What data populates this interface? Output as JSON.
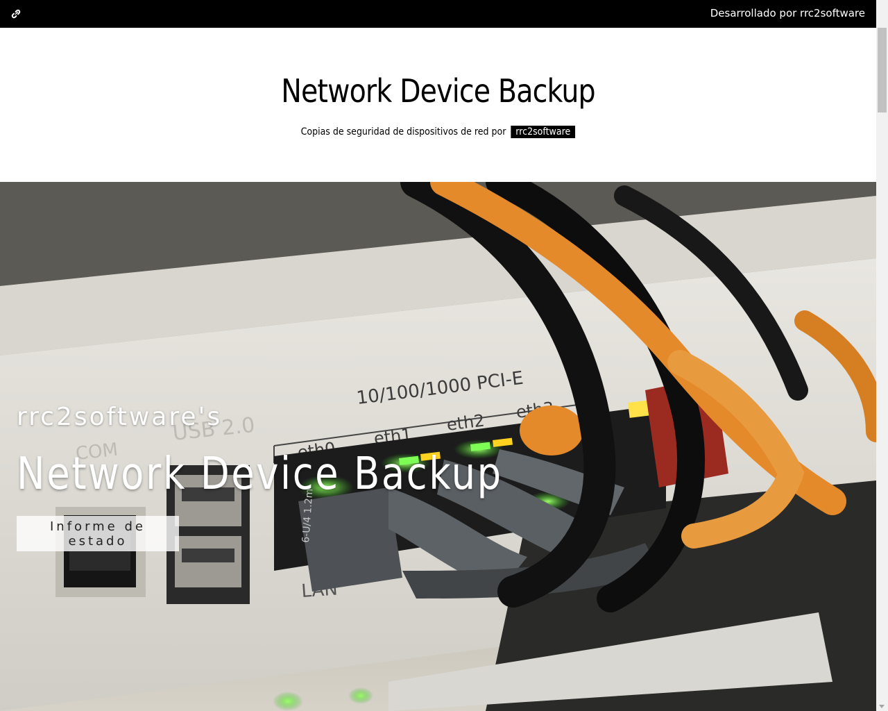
{
  "topbar": {
    "link_icon": "link-icon",
    "credit": "Desarrollado por rrc2software"
  },
  "header": {
    "title": "Network Device Backup",
    "subtitle_text": "Copias de seguridad de dispositivos de red por",
    "subtitle_tag": "rrc2software"
  },
  "hero": {
    "kicker": "rrc2software's",
    "title": "Network Device Backup",
    "button_label": "Informe de estado",
    "photo": {
      "panel_label": "10/100/1000 PCI-E",
      "ports": [
        "eth0",
        "eth1",
        "eth2",
        "eth3"
      ],
      "usb_label": "USB 2.0",
      "com_label": "COM",
      "lan_label": "LAN",
      "cable_label": "6-U/4 1.2m"
    }
  },
  "colors": {
    "topbar_bg": "#000000",
    "accent_orange": "#e58a2b",
    "led_green": "#55e03a"
  }
}
